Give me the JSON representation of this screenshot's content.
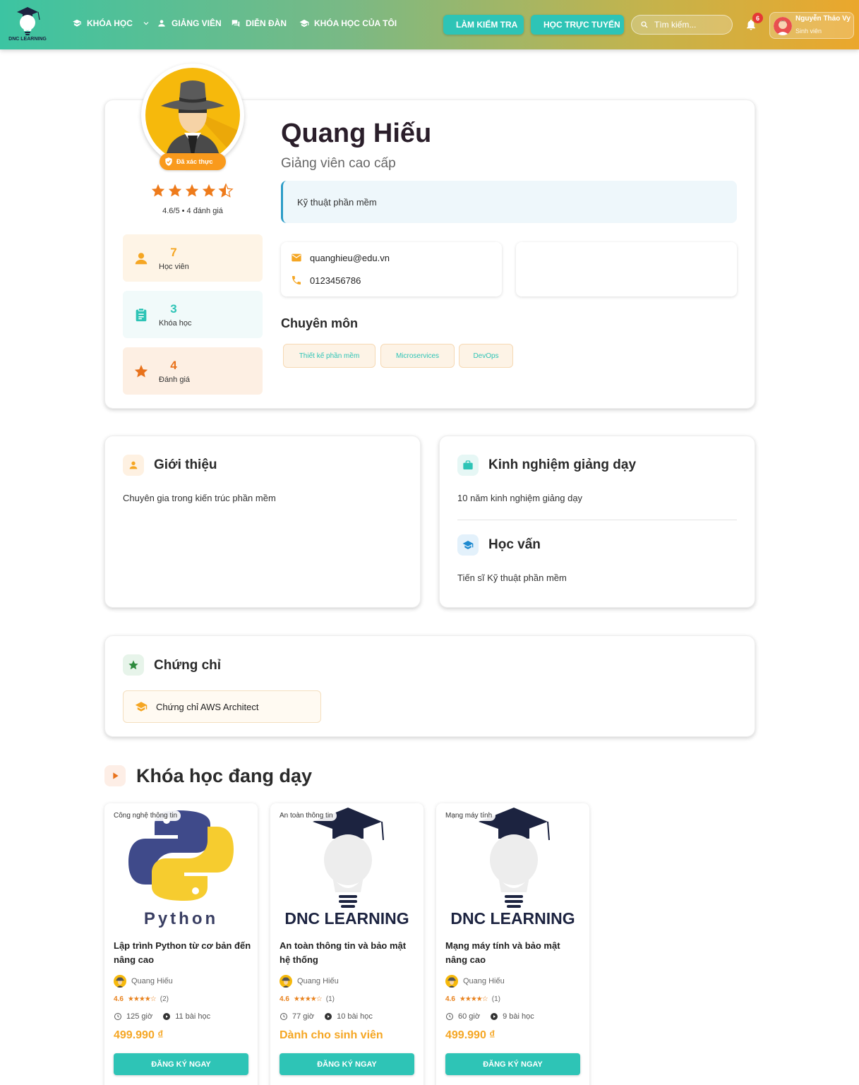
{
  "brand": {
    "name": "DNC LEARNING"
  },
  "nav": [
    {
      "label": "KHÓA HỌC",
      "icon": "book-icon",
      "dropdown": true
    },
    {
      "label": "GIẢNG VIÊN",
      "icon": "person-icon"
    },
    {
      "label": "DIỄN ĐÀN",
      "icon": "forum-icon"
    },
    {
      "label": "KHÓA HỌC CỦA TÔI",
      "icon": "graduation-icon"
    }
  ],
  "actions": {
    "quiz": "LÀM KIỂM TRA",
    "online": "HỌC TRỰC TUYẾN"
  },
  "search": {
    "placeholder": "Tìm kiếm..."
  },
  "notifications": {
    "count": "6"
  },
  "user": {
    "name": "Nguyễn Thảo Vy",
    "role": "Sinh viên"
  },
  "profile": {
    "verified": "Đã xác thực",
    "rating_value": 4.6,
    "rating_text": "4.6/5 • 4 đánh giá",
    "name": "Quang Hiếu",
    "title": "Giảng viên cao cấp",
    "department": "Kỹ thuật phần mềm",
    "email": "quanghieu@edu.vn",
    "phone": "0123456786",
    "stats": [
      {
        "value": "7",
        "label": "Học viên",
        "icon": "person-icon",
        "color": "#f5a623"
      },
      {
        "value": "3",
        "label": "Khóa học",
        "icon": "clipboard-icon",
        "color": "#2ec4b6"
      },
      {
        "value": "4",
        "label": "Đánh giá",
        "icon": "star-icon",
        "color": "#e8721c"
      }
    ],
    "specialty_heading": "Chuyên môn",
    "skills": [
      "Thiết kế phần mềm",
      "Microservices",
      "DevOps"
    ]
  },
  "intro": {
    "heading": "Giới thiệu",
    "text": "Chuyên gia trong kiến trúc phần mềm"
  },
  "experience": {
    "heading": "Kinh nghiệm giảng dạy",
    "text": "10 năm kinh nghiệm giảng dạy"
  },
  "education": {
    "heading": "Học vấn",
    "text": "Tiến sĩ Kỹ thuật phần mềm"
  },
  "certificates": {
    "heading": "Chứng chỉ",
    "items": [
      "Chứng chỉ AWS Architect"
    ]
  },
  "courses_heading": "Khóa học đang dạy",
  "courses": [
    {
      "category": "Công nghệ thông tin",
      "image": "python",
      "image_text": "Python",
      "title": "Lập trình Python từ cơ bản đến nâng cao",
      "instructor": "Quang Hiếu",
      "rating": "4.6",
      "stars": "★★★★☆",
      "reviews": "(2)",
      "hours": "125 giờ",
      "lessons": "11 bài học",
      "price": "499.990 ₫",
      "button": "ĐĂNG KÝ NGAY"
    },
    {
      "category": "An toàn thông tin",
      "image": "dnc",
      "image_text": "DNC LEARNING",
      "title": "An toàn thông tin và bảo mật hệ thống",
      "instructor": "Quang Hiếu",
      "rating": "4.6",
      "stars": "★★★★☆",
      "reviews": "(1)",
      "hours": "77 giờ",
      "lessons": "10 bài học",
      "price": "Dành cho sinh viên",
      "button": "ĐĂNG KÝ NGAY"
    },
    {
      "category": "Mạng máy tính",
      "image": "dnc",
      "image_text": "DNC LEARNING",
      "title": "Mạng máy tính và bảo mật nâng cao",
      "instructor": "Quang Hiếu",
      "rating": "4.6",
      "stars": "★★★★☆",
      "reviews": "(1)",
      "hours": "60 giờ",
      "lessons": "9 bài học",
      "price": "499.990 ₫",
      "button": "ĐĂNG KÝ NGAY"
    }
  ],
  "colors": {
    "accent": "#2ec4b6",
    "orange": "#f5a623"
  }
}
